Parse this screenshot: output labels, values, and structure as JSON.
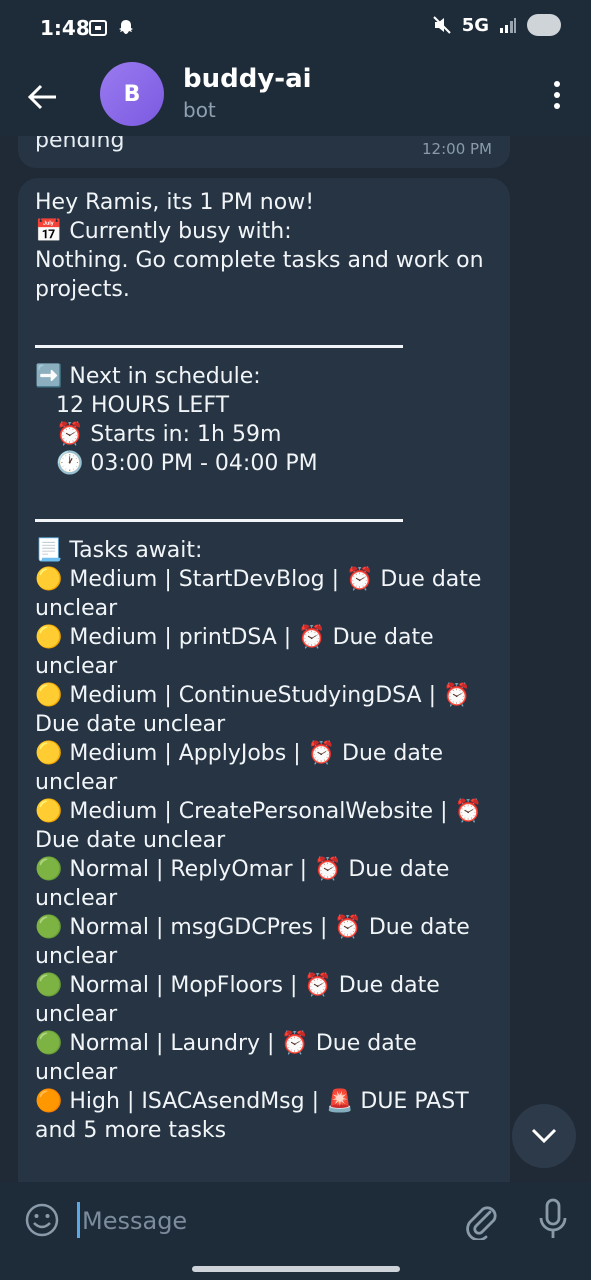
{
  "status_bar": {
    "time": "1:48",
    "network": "5G"
  },
  "header": {
    "avatar_letter": "B",
    "title": "buddy-ai",
    "subtitle": "bot"
  },
  "previous_message": {
    "text": "pending",
    "time": "12:00 PM"
  },
  "message": {
    "text": "Hey Ramis, its 1 PM now!\n📅 Currently busy with:\nNothing. Go complete tasks and work on projects.\n\n\n➡️ Next in schedule:\n   12 HOURS LEFT\n   ⏰ Starts in: 1h 59m\n   🕐 03:00 PM - 04:00 PM\n\n\n📃 Tasks await:\n🟡 Medium | StartDevBlog | ⏰ Due date unclear\n🟡 Medium | printDSA | ⏰ Due date unclear\n🟡 Medium | ContinueStudyingDSA | ⏰ Due date unclear\n🟡 Medium | ApplyJobs | ⏰ Due date unclear\n🟡 Medium | CreatePersonalWebsite | ⏰ Due date unclear\n🟢 Normal | ReplyOmar | ⏰ Due date unclear\n🟢 Normal | msgGDCPres | ⏰ Due date unclear\n🟢 Normal | MopFloors | ⏰ Due date unclear\n🟢 Normal | Laundry | ⏰ Due date unclear\n🟠 High | ISACAsendMsg | 🚨 DUE PAST\nand 5 more tasks"
  },
  "input": {
    "placeholder": "Message"
  },
  "colors": {
    "header_bg": "#1e2c3a",
    "chat_bg": "#1f2a36",
    "bubble_bg": "#263443",
    "avatar": "#8b6cf0",
    "caret": "#5aa9e6"
  }
}
